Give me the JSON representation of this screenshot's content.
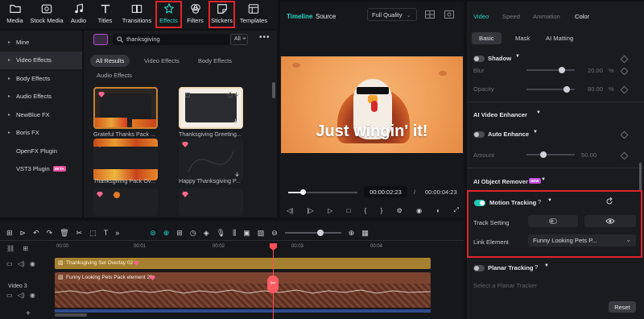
{
  "toolbar": {
    "items": [
      {
        "label": "Media",
        "icon": "folder-icon"
      },
      {
        "label": "Stock Media",
        "icon": "stock-media-icon"
      },
      {
        "label": "Audio",
        "icon": "music-note-icon"
      },
      {
        "label": "Titles",
        "icon": "titles-icon"
      },
      {
        "label": "Transitions",
        "icon": "transitions-icon"
      },
      {
        "label": "Effects",
        "icon": "effects-icon"
      },
      {
        "label": "Filters",
        "icon": "filters-icon"
      },
      {
        "label": "Stickers",
        "icon": "stickers-icon"
      },
      {
        "label": "Templates",
        "icon": "templates-icon"
      }
    ]
  },
  "sidebar": {
    "items": [
      {
        "label": "Mine"
      },
      {
        "label": "Video Effects"
      },
      {
        "label": "Body Effects"
      },
      {
        "label": "Audio Effects"
      },
      {
        "label": "NewBlue FX"
      },
      {
        "label": "Boris FX"
      },
      {
        "label": "OpenFX Plugin"
      },
      {
        "label": "VST3 Plugin",
        "badge": "BETA"
      }
    ]
  },
  "effects": {
    "search_value": "thanksgiving",
    "filter_label": "All",
    "chips": [
      "All Results",
      "Video Effects",
      "Body Effects",
      "Audio Effects"
    ],
    "thumbs": [
      {
        "label": "Grateful Thanks Pack ..."
      },
      {
        "label": "Thanksgiving Greeting..."
      },
      {
        "label": "Thanksgiving Pack Ov..."
      },
      {
        "label": "Happy Thanksgiving P..."
      }
    ]
  },
  "preview": {
    "tab_timeline": "Timeline",
    "tab_source": "Source",
    "quality": "Full Quality",
    "caption": "Just wingin' it!",
    "current_time": "00:00:02:23",
    "separator": "/",
    "total_time": "00:00:04:23",
    "progress": 0.21
  },
  "right_panel": {
    "tabs": [
      "Video",
      "Speed",
      "Animation",
      "Color"
    ],
    "subtabs": [
      "Basic",
      "Mask",
      "AI Matting"
    ],
    "shadow_label": "Shadow",
    "blur_label": "Blur",
    "blur_value": "20.00",
    "blur_unit": "%",
    "opacity_label": "Opacity",
    "opacity_value": "80.00",
    "opacity_unit": "%",
    "ai_video_enhancer": "AI Video Enhancer",
    "auto_enhance": "Auto Enhance",
    "amount_label": "Amount",
    "amount_value": "50.00",
    "ai_object_remover": "AI Object Remover",
    "new_badge": "NEW",
    "motion_tracking": "Motion Tracking",
    "track_setting": "Track Setting",
    "link_element": "Link Element",
    "link_value": "Funny Looking Pets P...",
    "planar_tracking": "Planar Tracking",
    "planar_placeholder": "Select a Planar Tracker",
    "reset": "Reset"
  },
  "timeline": {
    "ruler": [
      "00:00",
      "00:01",
      "00:02",
      "00:03",
      "00:04"
    ],
    "track1_clip": "Thanksgiving Set Overlay 02",
    "track2_label": "Video 3",
    "track2_clip": "Funny Looking Pets Pack element 20"
  },
  "colors": {
    "accent": "#25d7c4",
    "highlight": "#e0242b",
    "playhead": "#ff4d57"
  }
}
